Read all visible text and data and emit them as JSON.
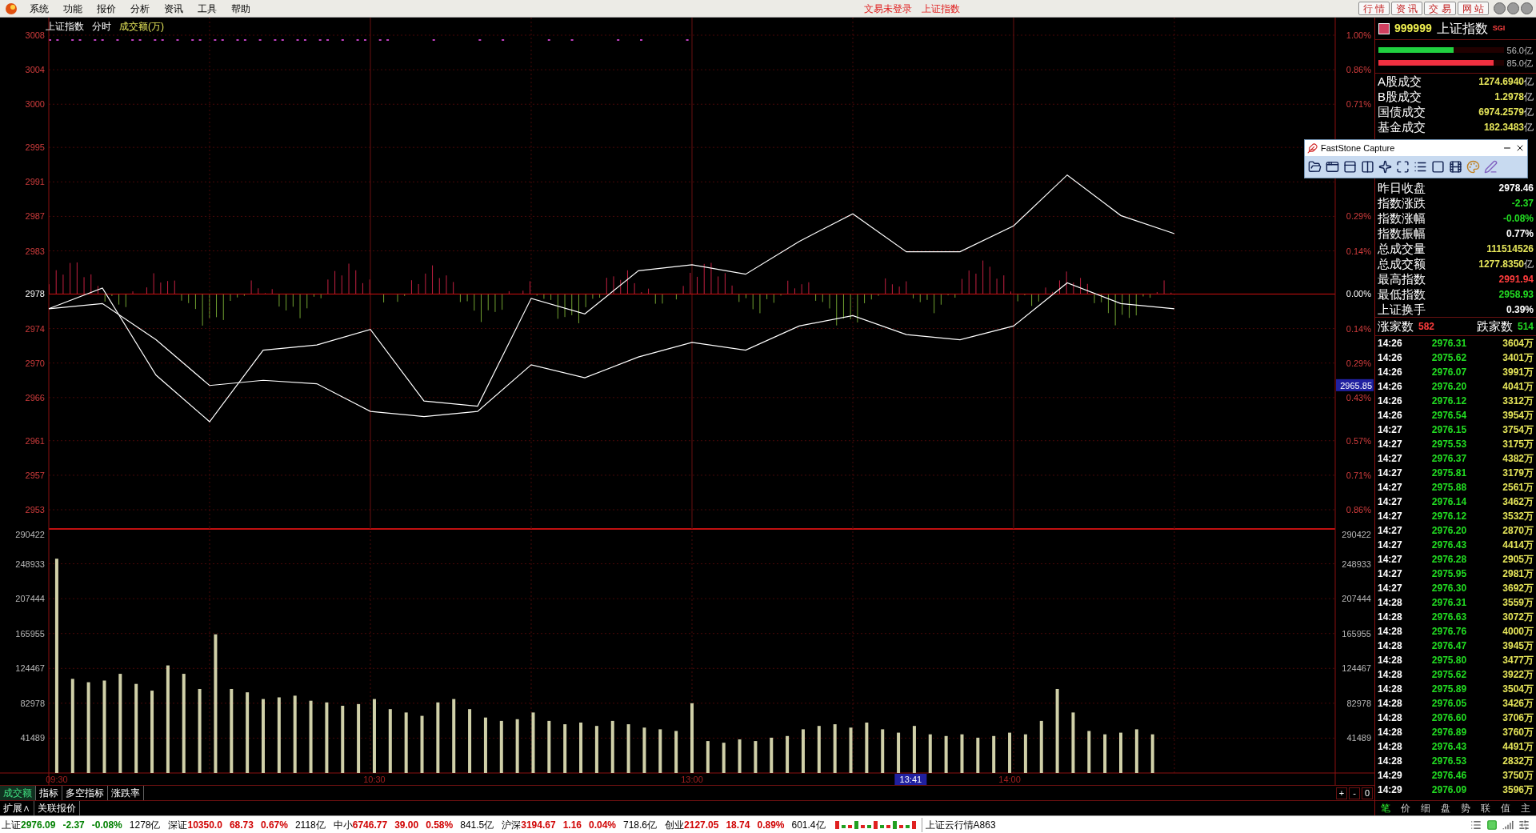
{
  "menu": {
    "items": [
      "系统",
      "功能",
      "报价",
      "分析",
      "资讯",
      "工具",
      "帮助"
    ],
    "notices": [
      "文易未登录",
      "上证指数"
    ],
    "nav_buttons": [
      "行 情",
      "资 讯",
      "交 易",
      "网 站"
    ]
  },
  "price_chart": {
    "header": [
      "上证指数",
      "分时",
      "成交额(万)"
    ],
    "percent_labels": {
      "upper": [
        "1.00%",
        "0.86%",
        "0.71%"
      ],
      "lower": [
        "0.29%",
        "0.14%",
        "0.00%",
        "0.14%",
        "0.29%",
        "0.43%",
        "0.57%",
        "0.71%",
        "0.86%"
      ]
    },
    "chart_data": {
      "type": "line",
      "grid": true,
      "ref_lines": [
        {
          "axis": "y",
          "value": 2978
        }
      ],
      "categories": [
        null,
        null,
        null,
        null,
        null,
        null,
        null,
        null,
        null,
        null,
        null,
        null,
        null,
        null,
        null,
        null,
        null,
        null,
        null,
        null,
        null,
        null,
        null,
        null,
        null
      ],
      "series": [
        {
          "color": "#ffffff",
          "values": [
            2976.3,
            2978.7,
            2968.6,
            2963.2,
            2971.5,
            2972.1,
            2973.9,
            2965.6,
            2965.0,
            2977.5,
            2975.7,
            2980.7,
            2981.4,
            2980.3,
            2984.1,
            2987.3,
            2982.9,
            2982.9,
            2985.9,
            2991.8,
            2987.1,
            2985.0,
            null,
            null,
            null
          ]
        },
        {
          "color": "#ffffff",
          "values": [
            2976.3,
            2976.9,
            2972.7,
            2967.4,
            2968.0,
            2967.6,
            2964.4,
            2963.8,
            2964.4,
            2969.8,
            2968.3,
            2970.7,
            2972.4,
            2971.5,
            2974.3,
            2975.5,
            2973.3,
            2972.7,
            2974.3,
            2979.3,
            2976.9,
            2976.3,
            null,
            null,
            null
          ]
        }
      ],
      "ylim": [
        2950.96,
        3010.04
      ],
      "yticks": [
        {
          "value": 3008,
          "label": "3008"
        },
        {
          "value": 3004,
          "label": "3004"
        },
        {
          "value": 3000,
          "label": "3000"
        },
        {
          "value": 2995,
          "label": "2995"
        },
        {
          "value": 2991,
          "label": "2991"
        },
        {
          "value": 2987,
          "label": "2987"
        },
        {
          "value": 2983,
          "label": "2983"
        },
        {
          "value": 2978,
          "label": "2978"
        },
        {
          "value": 2974,
          "label": "2974"
        },
        {
          "value": 2970,
          "label": "2970"
        },
        {
          "value": 2966,
          "label": "2966"
        },
        {
          "value": 2961,
          "label": "2961"
        },
        {
          "value": 2957,
          "label": "2957"
        },
        {
          "value": 2953,
          "label": "2953"
        }
      ],
      "annotations": [
        "2965.85"
      ]
    }
  },
  "volume_chart": {
    "right_labels": [
      "290422",
      "248933",
      "207444",
      "165955",
      "124467",
      "82978",
      "41489"
    ],
    "chart_data": {
      "type": "bar",
      "grid": true,
      "categories": [
        "09:30",
        null,
        null,
        null,
        null,
        null,
        null,
        null,
        null,
        null,
        null,
        null,
        null,
        null,
        null,
        null,
        null,
        null,
        null,
        null,
        "10:30",
        null,
        null,
        null,
        null,
        null,
        null,
        null,
        null,
        null,
        null,
        null,
        null,
        null,
        null,
        null,
        null,
        null,
        null,
        null,
        "13:00",
        null,
        null,
        null,
        null,
        null,
        null,
        null,
        null,
        null,
        null,
        null,
        null,
        null,
        null,
        null,
        null,
        null,
        null,
        null,
        "14:00",
        null,
        null,
        null,
        null,
        null,
        null,
        null,
        null,
        null,
        null,
        null,
        null,
        null,
        null,
        null,
        null,
        null,
        null,
        null,
        null
      ],
      "series": [
        {
          "color": "#d0d0a8",
          "values": [
            255000,
            112000,
            108000,
            110000,
            118000,
            106000,
            98000,
            128000,
            118000,
            100000,
            165000,
            100000,
            96000,
            88000,
            90000,
            92000,
            86000,
            84000,
            80000,
            82000,
            88000,
            76000,
            72000,
            68000,
            84000,
            88000,
            76000,
            66000,
            62000,
            64000,
            72000,
            62000,
            58000,
            60000,
            56000,
            62000,
            58000,
            54000,
            52000,
            50000,
            83000,
            38000,
            36000,
            40000,
            38000,
            42000,
            44000,
            52000,
            56000,
            58000,
            54000,
            60000,
            52000,
            48000,
            56000,
            46000,
            44000,
            46000,
            42000,
            44000,
            48000,
            46000,
            62000,
            100000,
            72000,
            50000,
            46000,
            48000,
            52000,
            46000,
            null,
            null,
            null,
            null,
            null,
            null,
            null,
            null,
            null,
            null,
            null
          ]
        }
      ],
      "ylim": [
        0,
        290422
      ],
      "yticks": [
        {
          "value": 290422,
          "label": "290422"
        },
        {
          "value": 248933,
          "label": "248933"
        },
        {
          "value": 207444,
          "label": "207444"
        },
        {
          "value": 165955,
          "label": "165955"
        },
        {
          "value": 124467,
          "label": "124467"
        },
        {
          "value": 82978,
          "label": "82978"
        },
        {
          "value": 41489,
          "label": "41489"
        }
      ],
      "annotations": [
        "13:41"
      ]
    }
  },
  "indicator_tabs": [
    {
      "label": "成交额",
      "selected": true
    },
    {
      "label": "指标",
      "selected": false
    },
    {
      "label": "多空指标",
      "selected": false
    },
    {
      "label": "涨跌率",
      "selected": false
    }
  ],
  "zoom_buttons": [
    "+",
    "-",
    "0"
  ],
  "extra_tabs": [
    "扩展∧",
    "关联报价"
  ],
  "quote_panel": {
    "code": "999999",
    "name": "上证指数",
    "badge": "SGI",
    "flow_bars": [
      {
        "level": 0.6,
        "label": "56.0亿",
        "color": "#20d040"
      },
      {
        "level": 0.92,
        "label": "85.0亿",
        "color": "#f03040"
      }
    ],
    "turnover_rows": [
      {
        "label": "A股成交",
        "value": "1274.6940",
        "unit": "亿"
      },
      {
        "label": "B股成交",
        "value": "1.2978",
        "unit": "亿"
      },
      {
        "label": "国债成交",
        "value": "6974.2579",
        "unit": "亿"
      },
      {
        "label": "基金成交",
        "value": "182.3483",
        "unit": "亿"
      }
    ],
    "stat_rows": [
      {
        "label": "昨日收盘",
        "value": "2978.46",
        "color": "#ffffff"
      },
      {
        "label": "指数涨跌",
        "value": "-2.37",
        "color": "#22dd22"
      },
      {
        "label": "指数涨幅",
        "value": "-0.08%",
        "color": "#22dd22"
      },
      {
        "label": "指数振幅",
        "value": "0.77%",
        "color": "#ffffff"
      },
      {
        "label": "总成交量",
        "value": "111514526",
        "color": "#e6e65a"
      },
      {
        "label": "总成交额",
        "value": "1277.8350",
        "unit": "亿",
        "color": "#e6e65a"
      },
      {
        "label": "最高指数",
        "value": "2991.94",
        "color": "#ff3c3c"
      },
      {
        "label": "最低指数",
        "value": "2958.93",
        "color": "#22dd22"
      },
      {
        "label": "上证换手",
        "value": "0.39%",
        "color": "#ffffff"
      }
    ],
    "breadth": [
      {
        "label": "涨家数",
        "value": "582",
        "color": "#ff3c3c"
      },
      {
        "label": "跌家数",
        "value": "514",
        "color": "#22dd22"
      }
    ],
    "ticks": [
      {
        "time": "14:26",
        "price": "2976.31",
        "volume": "3604万"
      },
      {
        "time": "14:26",
        "price": "2975.62",
        "volume": "3401万"
      },
      {
        "time": "14:26",
        "price": "2976.07",
        "volume": "3991万"
      },
      {
        "time": "14:26",
        "price": "2976.20",
        "volume": "4041万"
      },
      {
        "time": "14:26",
        "price": "2976.12",
        "volume": "3312万"
      },
      {
        "time": "14:26",
        "price": "2976.54",
        "volume": "3954万"
      },
      {
        "time": "14:27",
        "price": "2976.15",
        "volume": "3754万"
      },
      {
        "time": "14:27",
        "price": "2975.53",
        "volume": "3175万"
      },
      {
        "time": "14:27",
        "price": "2976.37",
        "volume": "4382万"
      },
      {
        "time": "14:27",
        "price": "2975.81",
        "volume": "3179万"
      },
      {
        "time": "14:27",
        "price": "2975.88",
        "volume": "2561万"
      },
      {
        "time": "14:27",
        "price": "2976.14",
        "volume": "3462万"
      },
      {
        "time": "14:27",
        "price": "2976.12",
        "volume": "3532万"
      },
      {
        "time": "14:27",
        "price": "2976.20",
        "volume": "2870万"
      },
      {
        "time": "14:27",
        "price": "2976.43",
        "volume": "4414万"
      },
      {
        "time": "14:27",
        "price": "2976.28",
        "volume": "2905万"
      },
      {
        "time": "14:27",
        "price": "2975.95",
        "volume": "2981万"
      },
      {
        "time": "14:27",
        "price": "2976.30",
        "volume": "3692万"
      },
      {
        "time": "14:28",
        "price": "2976.31",
        "volume": "3559万"
      },
      {
        "time": "14:28",
        "price": "2976.63",
        "volume": "3072万"
      },
      {
        "time": "14:28",
        "price": "2976.76",
        "volume": "4000万"
      },
      {
        "time": "14:28",
        "price": "2976.47",
        "volume": "3945万"
      },
      {
        "time": "14:28",
        "price": "2975.80",
        "volume": "3477万"
      },
      {
        "time": "14:28",
        "price": "2975.62",
        "volume": "3922万"
      },
      {
        "time": "14:28",
        "price": "2975.89",
        "volume": "3504万"
      },
      {
        "time": "14:28",
        "price": "2976.05",
        "volume": "3426万"
      },
      {
        "time": "14:28",
        "price": "2976.60",
        "volume": "3706万"
      },
      {
        "time": "14:28",
        "price": "2976.89",
        "volume": "3760万"
      },
      {
        "time": "14:28",
        "price": "2976.43",
        "volume": "4491万"
      },
      {
        "time": "14:28",
        "price": "2976.53",
        "volume": "2832万"
      },
      {
        "time": "14:29",
        "price": "2976.46",
        "volume": "3750万"
      },
      {
        "time": "14:29",
        "price": "2976.09",
        "volume": "3596万"
      }
    ],
    "tabs": [
      {
        "label": "笔",
        "selected": true
      },
      {
        "label": "价",
        "selected": false
      },
      {
        "label": "细",
        "selected": false
      },
      {
        "label": "盘",
        "selected": false
      },
      {
        "label": "势",
        "selected": false
      },
      {
        "label": "联",
        "selected": false
      },
      {
        "label": "值",
        "selected": false
      },
      {
        "label": "主",
        "selected": false
      }
    ]
  },
  "capture_window": {
    "title": "FastStone Capture"
  },
  "status_bar": {
    "indices": [
      {
        "name": "上证",
        "price": "2976.09",
        "change": "-2.37",
        "pct": "-0.08%",
        "amount": "1278亿",
        "color": "#008000"
      },
      {
        "name": "深证",
        "price": "10350.0",
        "change": "68.73",
        "pct": "0.67%",
        "amount": "2118亿",
        "color": "#d00000"
      },
      {
        "name": "中小",
        "price": "6746.77",
        "change": "39.00",
        "pct": "0.58%",
        "amount": "841.5亿",
        "color": "#d00000"
      },
      {
        "name": "沪深",
        "price": "3194.67",
        "change": "1.16",
        "pct": "0.04%",
        "amount": "718.6亿",
        "color": "#d00000"
      },
      {
        "name": "创业",
        "price": "2127.05",
        "change": "18.74",
        "pct": "0.89%",
        "amount": "601.4亿",
        "color": "#d00000"
      }
    ],
    "service": "上证云行情A863"
  }
}
